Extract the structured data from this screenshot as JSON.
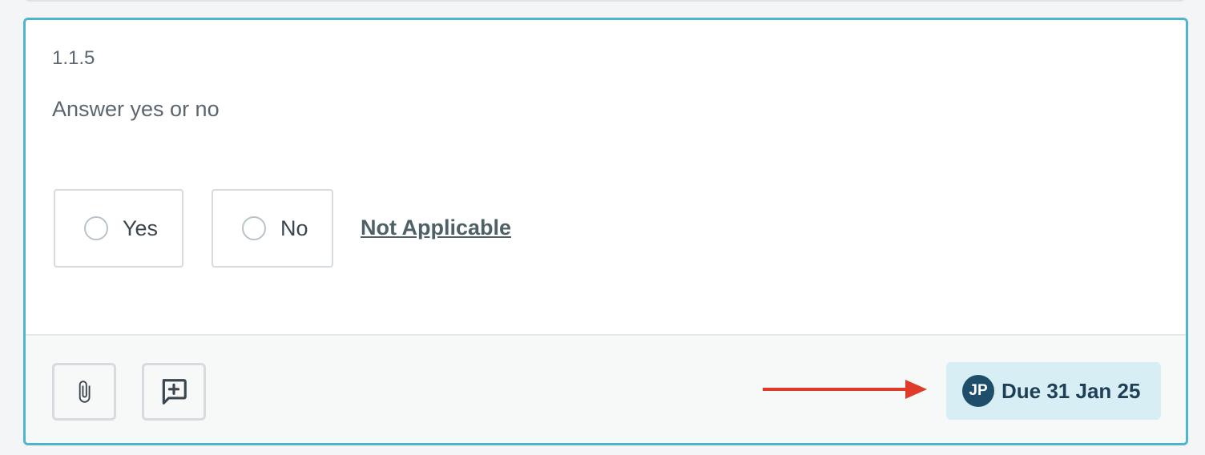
{
  "question": {
    "number": "1.1.5",
    "text": "Answer yes or no"
  },
  "options": {
    "yes_label": "Yes",
    "no_label": "No",
    "not_applicable_label": "Not Applicable"
  },
  "footer": {
    "attach_icon": "paperclip-icon",
    "comment_icon": "add-comment-icon",
    "assignee_initials": "JP",
    "due_label": "Due 31 Jan 25"
  },
  "colors": {
    "card_border": "#4fb5cf",
    "badge_background": "#d6eef4",
    "avatar_background": "#1f4e6b",
    "arrow": "#e03a2a"
  }
}
